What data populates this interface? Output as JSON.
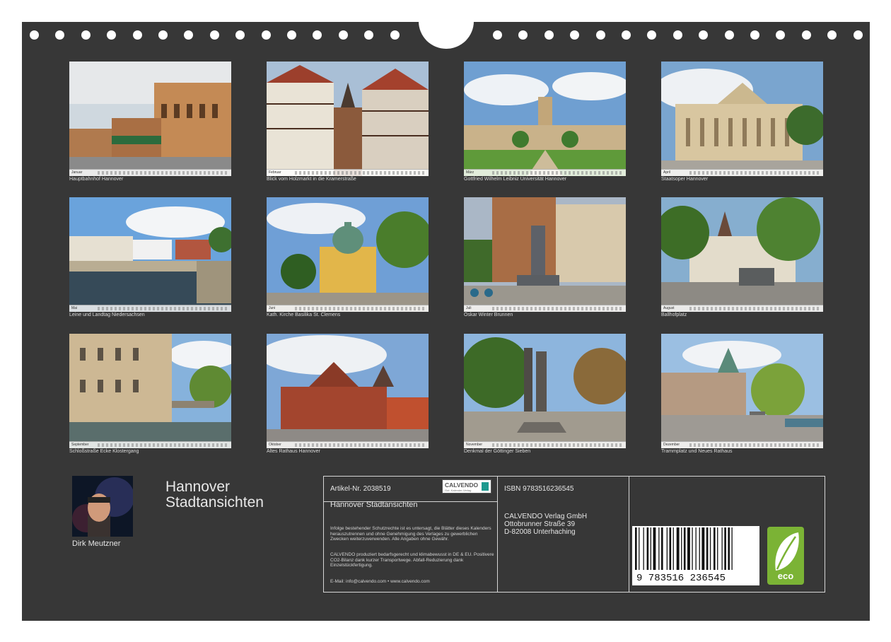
{
  "months": [
    {
      "caption": "Hauptbahnhof Hannover",
      "month": "Januar",
      "year": "2026"
    },
    {
      "caption": "Blick vom Holzmarkt in die Kramerstraße",
      "month": "Februar",
      "year": "2026"
    },
    {
      "caption": "Gottfried Wilhelm Leibniz Universität Hannover",
      "month": "März",
      "year": "2026"
    },
    {
      "caption": "Staatsoper Hannover",
      "month": "April",
      "year": "2026"
    },
    {
      "caption": "Leine und Landtag Niedersachsen",
      "month": "Mai",
      "year": "2026"
    },
    {
      "caption": "Kath. Kirche Basilika St. Clemens",
      "month": "Juni",
      "year": "2026"
    },
    {
      "caption": "Oskar Winter Brunnen",
      "month": "Juli",
      "year": "2026"
    },
    {
      "caption": "Ballhofplatz",
      "month": "August",
      "year": "2026"
    },
    {
      "caption": "Schloßstraße Ecke Klostergang",
      "month": "September",
      "year": "2026"
    },
    {
      "caption": "Altes Rathaus Hannover",
      "month": "Oktober",
      "year": "2026"
    },
    {
      "caption": "Denkmal der Göttinger Sieben",
      "month": "November",
      "year": "2026"
    },
    {
      "caption": "Trammplatz und Neues Rathaus",
      "month": "Dezember",
      "year": "2026"
    }
  ],
  "author": {
    "name": "Dirk Meutzner"
  },
  "title": {
    "line1": "Hannover",
    "line2": "Stadtansichten"
  },
  "info": {
    "article": "Artikel-Nr. 2038519",
    "logo_text": "CALVENDO",
    "logo_sub": "Gut. Kalender-Verlag",
    "product_title": "Hannover Stadtansichten",
    "legal1": "Infolge bestehender Schutzrechte ist es untersagt, die Blätter dieses Kalenders herauszutrennen und ohne Genehmigung des Verlages zu gewerblichen Zwecken weiterzuverwenden. Alle Angaben ohne Gewähr.",
    "legal2": "CALVENDO produziert bedarfsgerecht und klimabewusst in DE & EU. Positivere CO2-Bilanz dank kurzer Transportwege. Abfall-Reduzierung dank Einzelstückfertigung.",
    "contact": "E-Mail: info@calvendo.com • www.calvendo.com",
    "isbn": "ISBN 9783516236545",
    "publisher1": "CALVENDO Verlag GmbH",
    "publisher2": "Ottobrunner Straße 39",
    "publisher3": "D-82008 Unterhaching",
    "barcode_digits": "9 783516 236545",
    "eco_label": "eco"
  }
}
